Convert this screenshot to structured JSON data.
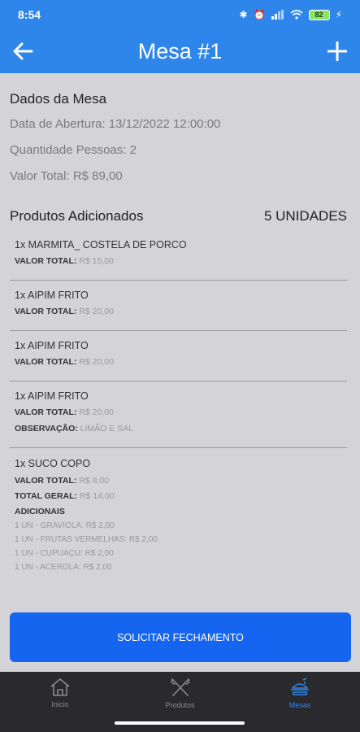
{
  "status": {
    "time": "8:54",
    "battery": "82"
  },
  "header": {
    "title": "Mesa #1"
  },
  "mesa": {
    "section_title": "Dados da Mesa",
    "abertura": "Data de Abertura: 13/12/2022 12:00:00",
    "pessoas": "Quantidade Pessoas: 2",
    "total": "Valor Total: R$ 89,00"
  },
  "produtos": {
    "section_title": "Produtos Adicionados",
    "unidades": "5 UNIDADES",
    "items": [
      {
        "name": "1x MARMITA_ COSTELA DE PORCO",
        "valor_label": "VALOR TOTAL:",
        "valor": "R$ 15,00"
      },
      {
        "name": "1x AIPIM FRITO",
        "valor_label": "VALOR TOTAL:",
        "valor": "R$ 20,00"
      },
      {
        "name": "1x AIPIM FRITO",
        "valor_label": "VALOR TOTAL:",
        "valor": "R$ 20,00"
      },
      {
        "name": "1x AIPIM FRITO",
        "valor_label": "VALOR TOTAL:",
        "valor": "R$ 20,00",
        "obs_label": "OBSERVAÇÃO:",
        "obs": "LIMÃO E SAL"
      },
      {
        "name": "1x SUCO COPO",
        "valor_label": "VALOR TOTAL:",
        "valor": "R$ 8,00",
        "geral_label": "TOTAL GERAL:",
        "geral": "R$ 14,00",
        "adicionais_label": "ADICIONAIS",
        "adicionais": [
          "1 UN - GRAVIOLA: R$ 2,00",
          "1 UN - FRUTAS VERMELHAS: R$ 2,00",
          "1 UN - CUPUAÇU: R$ 2,00",
          "1 UN - ACEROLA: R$ 2,00"
        ]
      }
    ]
  },
  "actions": {
    "fechamento": "SOLICITAR FECHAMENTO"
  },
  "nav": {
    "inicio": "Inicio",
    "produtos": "Produtos",
    "mesas": "Mesas"
  },
  "colors": {
    "primary": "#2f86ea",
    "button": "#1565f0",
    "nav_bg": "#2a2a2e"
  }
}
